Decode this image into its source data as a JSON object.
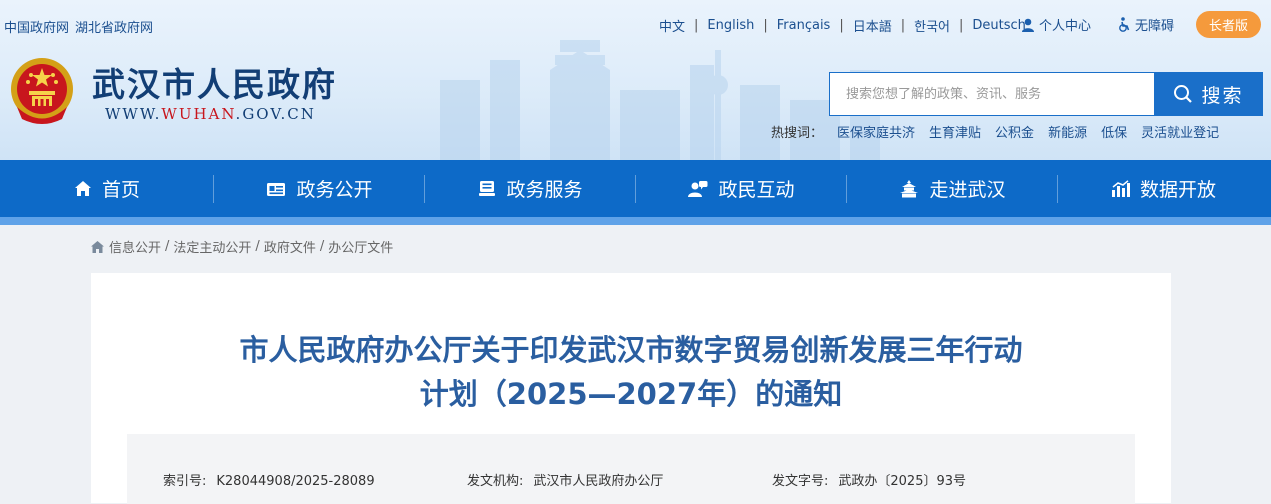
{
  "top_links": [
    "中国政府网",
    "湖北省政府网"
  ],
  "languages": [
    "中文",
    "English",
    "Français",
    "日本語",
    "한국어",
    "Deutsch"
  ],
  "user_center": "个人中心",
  "accessibility": "无障碍",
  "elder_mode": "长者版",
  "site": {
    "title": "武汉市人民政府",
    "domain_prefix": "WWW.",
    "domain_highlight": "WUHAN",
    "domain_suffix": ".GOV.CN"
  },
  "search": {
    "placeholder": "搜索您想了解的政策、资讯、服务",
    "button": "搜索"
  },
  "hot_search": {
    "label": "热搜词：",
    "items": [
      "医保家庭共济",
      "生育津贴",
      "公积金",
      "新能源",
      "低保",
      "灵活就业登记"
    ]
  },
  "nav": [
    "首页",
    "政务公开",
    "政务服务",
    "政民互动",
    "走进武汉",
    "数据开放"
  ],
  "breadcrumb": [
    "信息公开",
    "法定主动公开",
    "政府文件",
    "办公厅文件"
  ],
  "document": {
    "title_line1": "市人民政府办公厅关于印发武汉市数字贸易创新发展三年行动",
    "title_line2": "计划（2025—2027年）的通知",
    "meta": [
      {
        "key": "索引号:",
        "value": "K28044908/2025-28089"
      },
      {
        "key": "发文机构:",
        "value": "武汉市人民政府办公厅"
      },
      {
        "key": "发文字号:",
        "value": "武政办〔2025〕93号"
      }
    ]
  },
  "colors": {
    "nav_bg": "#0d6ac8",
    "title_blue": "#2a5ea0",
    "elder_orange": "#f59a3c",
    "emblem_red": "#c8161d"
  }
}
